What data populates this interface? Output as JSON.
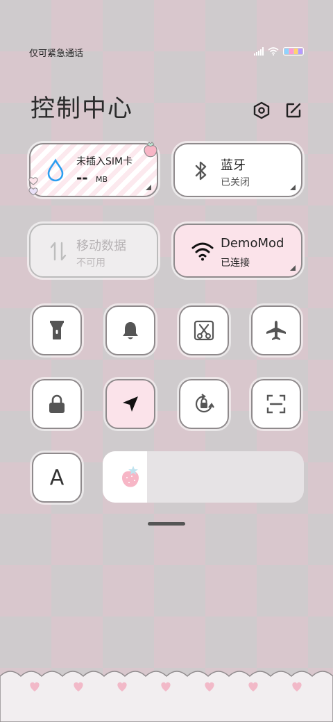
{
  "status_bar": {
    "carrier_text": "仅可紧急通话",
    "signal_icon": "signal-bars-icon",
    "wifi_icon": "wifi-icon",
    "battery_icon": "battery-icon",
    "battery_colors": [
      "#8fd3ff",
      "#ff9ad0",
      "#ffd36e",
      "#b59bff"
    ]
  },
  "header": {
    "title": "控制中心",
    "settings_icon": "settings-hexagon-icon",
    "edit_icon": "edit-icon"
  },
  "cards": {
    "data_usage": {
      "title": "未插入SIM卡",
      "value": "--",
      "unit": "MB",
      "icon": "water-drop-icon"
    },
    "bluetooth": {
      "title": "蓝牙",
      "status": "已关闭",
      "icon": "bluetooth-icon"
    },
    "mobile_data": {
      "title": "移动数据",
      "status": "不可用",
      "icon": "mobile-data-arrows-icon"
    },
    "wifi": {
      "title": "DemoMod",
      "status": "已连接",
      "icon": "wifi-icon"
    }
  },
  "toggles": [
    {
      "name": "flashlight",
      "icon": "flashlight-icon",
      "active": false
    },
    {
      "name": "ringer",
      "icon": "bell-icon",
      "active": false
    },
    {
      "name": "screenshot",
      "icon": "scissors-screenshot-icon",
      "active": false
    },
    {
      "name": "airplane-mode",
      "icon": "airplane-icon",
      "active": false
    },
    {
      "name": "lock-screen",
      "icon": "lock-icon",
      "active": false
    },
    {
      "name": "location",
      "icon": "location-arrow-icon",
      "active": true
    },
    {
      "name": "auto-rotate",
      "icon": "rotate-lock-icon",
      "active": false
    },
    {
      "name": "scanner",
      "icon": "scan-frame-icon",
      "active": false
    },
    {
      "name": "font-size",
      "icon": "text-a-icon",
      "label": "A",
      "active": false
    }
  ],
  "brightness_slider": {
    "icon": "strawberry-icon",
    "level": 0.22
  },
  "colors": {
    "active_pink": "#fbe3ea",
    "border_gray": "#8f8a8c",
    "accent_blue": "#2c9ef0",
    "icon_gray": "#555555"
  }
}
